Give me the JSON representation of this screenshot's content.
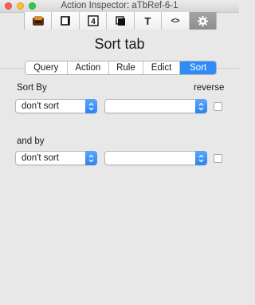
{
  "window": {
    "title": "Action Inspector: aTbRef-6-1"
  },
  "toolbar": {
    "tabs": [
      {
        "icon": "color-palette-icon"
      },
      {
        "icon": "note-appearance-icon"
      },
      {
        "icon": "text-size-icon",
        "label": "4"
      },
      {
        "icon": "layered-windows-icon"
      },
      {
        "icon": "text-icon",
        "label": "T"
      },
      {
        "icon": "html-code-icon",
        "label": "<>"
      },
      {
        "icon": "gear-icon"
      }
    ],
    "active_index": 6
  },
  "heading": "Sort tab",
  "segments": {
    "items": [
      "Query",
      "Action",
      "Rule",
      "Edict",
      "Sort"
    ],
    "selected": "Sort"
  },
  "sort_by": {
    "label": "Sort By",
    "reverse_label": "reverse",
    "attribute_value": "don't sort",
    "secondary_value": "",
    "reverse_checked": false
  },
  "and_by": {
    "label": "and by",
    "attribute_value": "don't sort",
    "secondary_value": "",
    "reverse_checked": false
  },
  "colors": {
    "accent": "#2f8cf7",
    "background": "#e8e8e8"
  }
}
